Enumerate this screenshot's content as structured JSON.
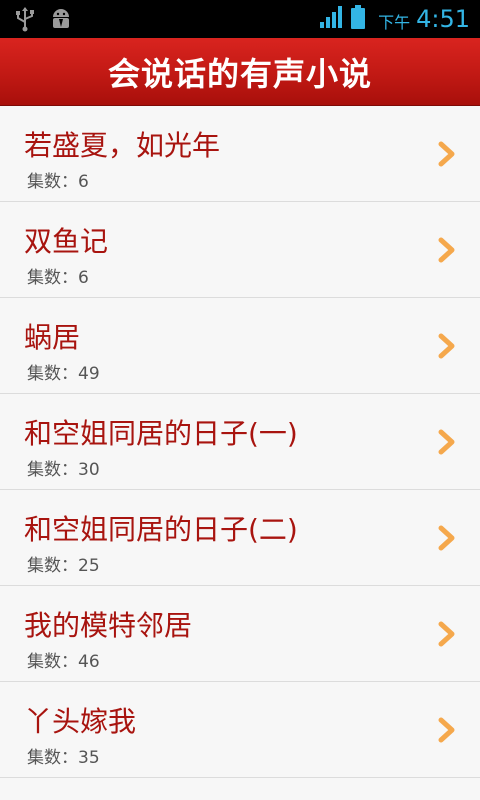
{
  "status_bar": {
    "icons": [
      "usb-icon",
      "android-debug-icon",
      "signal-icon",
      "battery-icon"
    ],
    "ampm": "下午",
    "time": "4:51"
  },
  "header": {
    "title": "会说话的有声小说"
  },
  "episode_label": "集数：",
  "colors": {
    "header": "#c11914",
    "title_text": "#a8140f",
    "chevron": "#f5a84c",
    "status_accent": "#33b5e5"
  },
  "items": [
    {
      "title": "若盛夏，如光年",
      "episodes": "6"
    },
    {
      "title": "双鱼记",
      "episodes": "6"
    },
    {
      "title": "蜗居",
      "episodes": "49"
    },
    {
      "title": "和空姐同居的日子(一)",
      "episodes": "30"
    },
    {
      "title": "和空姐同居的日子(二)",
      "episodes": "25"
    },
    {
      "title": "我的模特邻居",
      "episodes": "46"
    },
    {
      "title": "丫头嫁我",
      "episodes": "35"
    }
  ]
}
